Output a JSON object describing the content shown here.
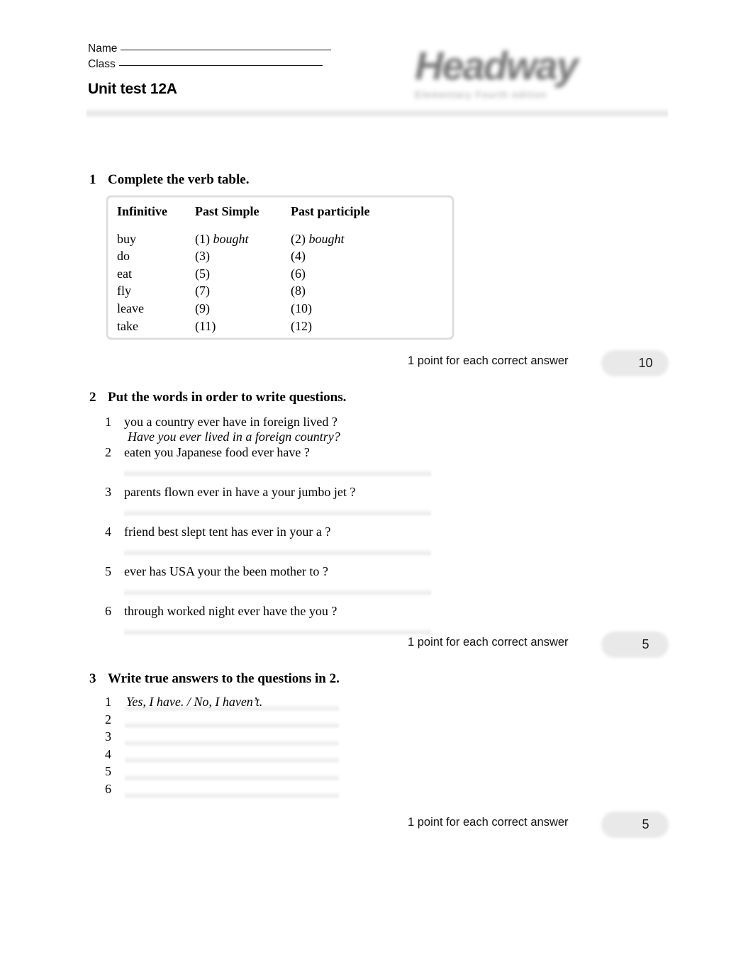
{
  "header": {
    "name_label": "Name",
    "class_label": "Class",
    "title": "Unit test 12A",
    "logo_word": "Headway",
    "logo_sub": "Elementary    Fourth edition"
  },
  "exercises": [
    {
      "number": "1",
      "instruction": "Complete the verb table.",
      "score_label": "1 point for each correct answer",
      "score_value": "10",
      "table": {
        "columns": [
          "Infinitive",
          "Past Simple",
          "Past participle"
        ],
        "rows": [
          {
            "infinitive": "buy",
            "past_simple": "(1)",
            "past_simple_answer": "bought",
            "past_participle": "(2)",
            "past_participle_answer": "bought"
          },
          {
            "infinitive": "do",
            "past_simple": "(3)",
            "past_simple_answer": "",
            "past_participle": "(4)",
            "past_participle_answer": ""
          },
          {
            "infinitive": "eat",
            "past_simple": "(5)",
            "past_simple_answer": "",
            "past_participle": "(6)",
            "past_participle_answer": ""
          },
          {
            "infinitive": "fly",
            "past_simple": "(7)",
            "past_simple_answer": "",
            "past_participle": "(8)",
            "past_participle_answer": ""
          },
          {
            "infinitive": "leave",
            "past_simple": "(9)",
            "past_simple_answer": "",
            "past_participle": "(10)",
            "past_participle_answer": ""
          },
          {
            "infinitive": "take",
            "past_simple": "(11)",
            "past_simple_answer": "",
            "past_participle": "(12)",
            "past_participle_answer": ""
          }
        ]
      }
    },
    {
      "number": "2",
      "instruction": "Put the words in order to write questions.",
      "score_label": "1 point for each correct answer",
      "score_value": "5",
      "questions": [
        {
          "num": "1",
          "text": "you a country ever have in foreign lived ?",
          "answer": "Have you ever lived in a foreign country?"
        },
        {
          "num": "2",
          "text": "eaten you Japanese food ever have ?",
          "answer": ""
        },
        {
          "num": "3",
          "text": "parents flown ever in have a your jumbo jet ?",
          "answer": ""
        },
        {
          "num": "4",
          "text": "friend best slept tent has ever in your a ?",
          "answer": ""
        },
        {
          "num": "5",
          "text": "ever has USA your the been mother to ?",
          "answer": ""
        },
        {
          "num": "6",
          "text": "through worked night ever have the you ?",
          "answer": ""
        }
      ]
    },
    {
      "number": "3",
      "instruction": "Write true answers to the questions in 2.",
      "score_label": "1 point for each correct answer",
      "score_value": "5",
      "answers": [
        {
          "num": "1",
          "text": "Yes, I have. / No, I haven’t."
        },
        {
          "num": "2",
          "text": ""
        },
        {
          "num": "3",
          "text": ""
        },
        {
          "num": "4",
          "text": ""
        },
        {
          "num": "5",
          "text": ""
        },
        {
          "num": "6",
          "text": ""
        }
      ]
    }
  ]
}
